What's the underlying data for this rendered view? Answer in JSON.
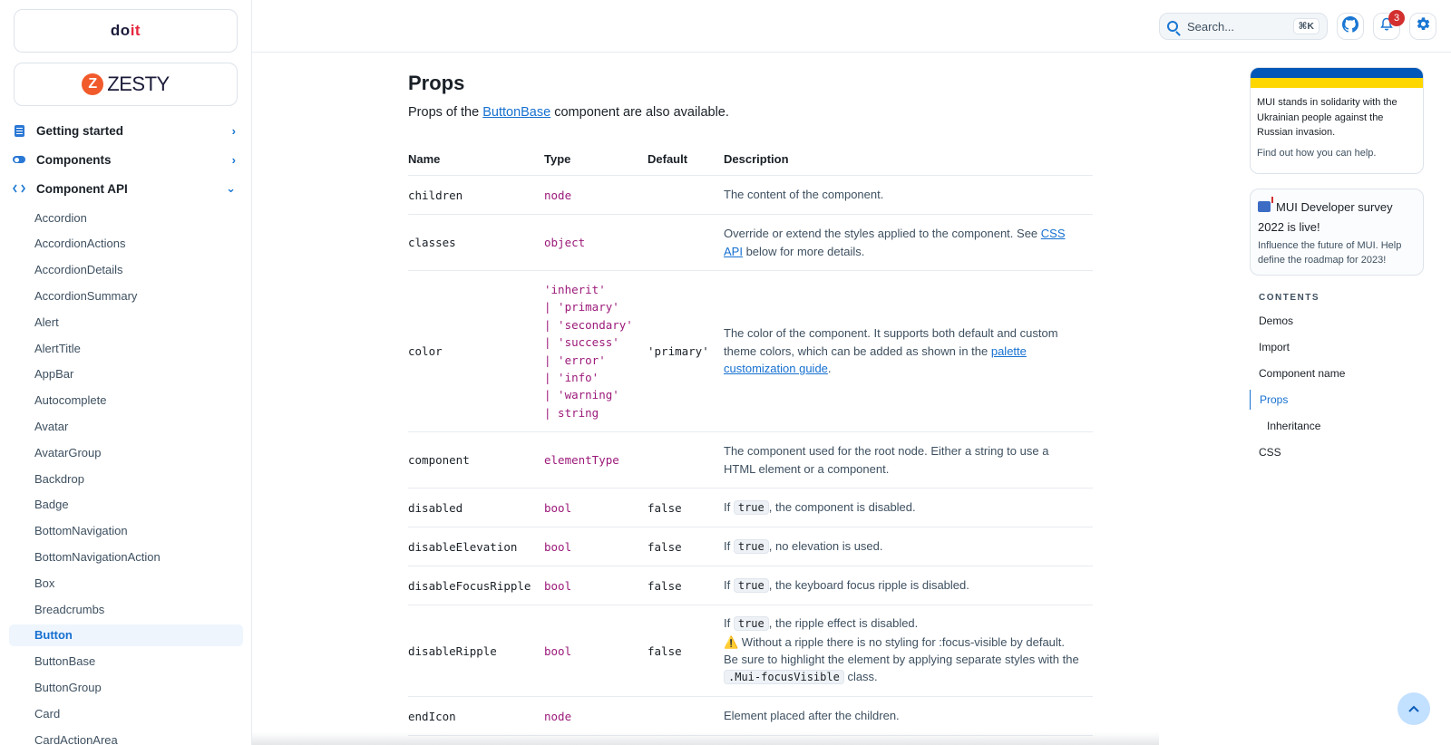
{
  "sponsors": {
    "doit": {
      "prefix": "do",
      "accent": "it"
    },
    "zesty": {
      "mark": "Z",
      "word": "ZESTY"
    }
  },
  "sidebar": {
    "sections": [
      {
        "label": "Getting started",
        "chevron": "›"
      },
      {
        "label": "Components",
        "chevron": "›"
      },
      {
        "label": "Component API",
        "chevron": "⌄"
      }
    ],
    "items": [
      "Accordion",
      "AccordionActions",
      "AccordionDetails",
      "AccordionSummary",
      "Alert",
      "AlertTitle",
      "AppBar",
      "Autocomplete",
      "Avatar",
      "AvatarGroup",
      "Backdrop",
      "Badge",
      "BottomNavigation",
      "BottomNavigationAction",
      "Box",
      "Breadcrumbs",
      "Button",
      "ButtonBase",
      "ButtonGroup",
      "Card",
      "CardActionArea"
    ],
    "active_item": "Button"
  },
  "topbar": {
    "search_placeholder": "Search...",
    "search_shortcut": "⌘K",
    "notification_count": "3"
  },
  "main": {
    "title": "Props",
    "subtitle_prefix": "Props of the ",
    "subtitle_link": "ButtonBase",
    "subtitle_suffix": " component are also available.",
    "headers": {
      "name": "Name",
      "type": "Type",
      "default": "Default",
      "description": "Description"
    },
    "rows": [
      {
        "name": "children",
        "type": "node",
        "default": "",
        "desc": "The content of the component."
      },
      {
        "name": "classes",
        "type": "object",
        "default": "",
        "desc_pre": "Override or extend the styles applied to the component. See ",
        "desc_link": "CSS API",
        "desc_post": " below for more details."
      },
      {
        "name": "color",
        "type_lines": [
          "'inherit'",
          "| 'primary'",
          "| 'secondary'",
          "| 'success'",
          "| 'error'",
          "| 'info'",
          "| 'warning'",
          "| string"
        ],
        "default": "'primary'",
        "desc_pre": "The color of the component. It supports both default and custom theme colors, which can be added as shown in the ",
        "desc_link": "palette customization guide",
        "desc_post": "."
      },
      {
        "name": "component",
        "type": "elementType",
        "default": "",
        "desc": "The component used for the root node. Either a string to use a HTML element or a component."
      },
      {
        "name": "disabled",
        "type": "bool",
        "default": "false",
        "desc_if": "If ",
        "desc_code": "true",
        "desc_post": ", the component is disabled."
      },
      {
        "name": "disableElevation",
        "type": "bool",
        "default": "false",
        "desc_if": "If ",
        "desc_code": "true",
        "desc_post": ", no elevation is used."
      },
      {
        "name": "disableFocusRipple",
        "type": "bool",
        "default": "false",
        "desc_if": "If ",
        "desc_code": "true",
        "desc_post": ", the keyboard focus ripple is disabled."
      },
      {
        "name": "disableRipple",
        "type": "bool",
        "default": "false",
        "desc_if": "If ",
        "desc_code": "true",
        "desc_post": ", the ripple effect is disabled.",
        "desc_warn_icon": "⚠️",
        "desc_warn": " Without a ripple there is no styling for :focus-visible by default. Be sure to highlight the element by applying separate styles with the ",
        "desc_warn_code": ".Mui-focusVisible",
        "desc_warn_post": " class."
      },
      {
        "name": "endIcon",
        "type": "node",
        "default": "",
        "desc": "Element placed after the children."
      }
    ]
  },
  "right": {
    "ukraine_text": "MUI stands in solidarity with the Ukrainian people against the Russian invasion.",
    "ukraine_help": "Find out how you can help.",
    "survey_title": "MUI Developer survey 2022 is live!",
    "survey_sub": "Influence the future of MUI. Help define the roadmap for 2023!",
    "contents_title": "CONTENTS",
    "toc": [
      {
        "label": "Demos"
      },
      {
        "label": "Import"
      },
      {
        "label": "Component name"
      },
      {
        "label": "Props"
      },
      {
        "label": "Inheritance"
      },
      {
        "label": "CSS"
      }
    ]
  },
  "colors": {
    "accent": "#1670d0",
    "type": "#9c1a7a",
    "active_bg": "#eef5fd",
    "badge": "#d32f2f",
    "ukraine_blue": "#0057b7",
    "ukraine_yellow": "#ffd700"
  }
}
